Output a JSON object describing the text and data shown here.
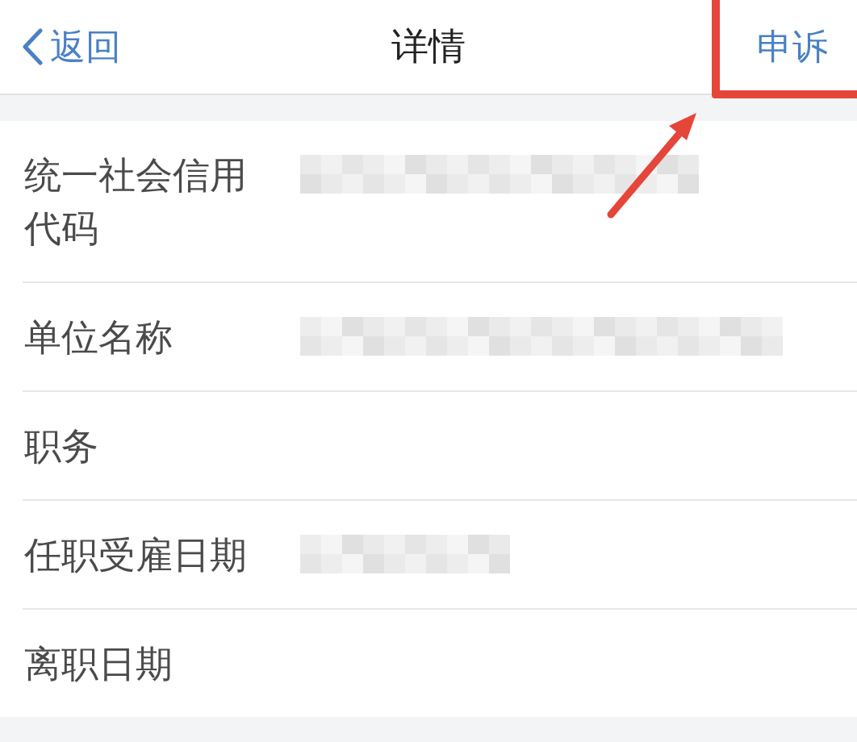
{
  "nav_bar": {
    "back_label": "返回",
    "title": "详情",
    "action_label": "申诉",
    "action_highlighted": true
  },
  "fields": [
    {
      "label": "统一社会信用代码",
      "redacted": true
    },
    {
      "label": "单位名称",
      "redacted": true
    },
    {
      "label": "职务",
      "redacted": false
    },
    {
      "label": "任职受雇日期",
      "redacted": true
    },
    {
      "label": "离职日期",
      "redacted": false
    }
  ]
}
